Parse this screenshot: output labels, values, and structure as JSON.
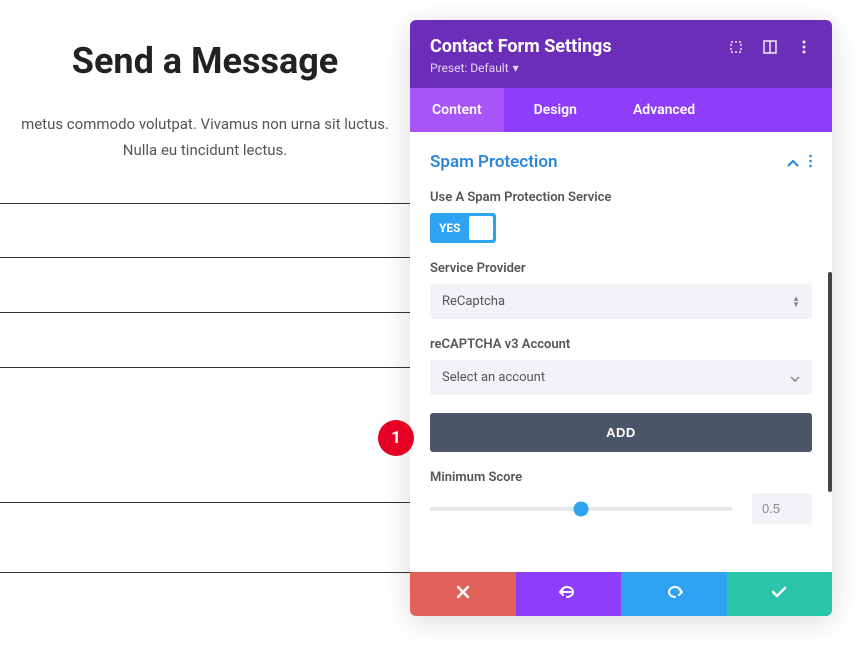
{
  "page": {
    "title": "Send a Message",
    "description": "metus commodo volutpat. Vivamus non urna sit luctus. Nulla eu tincidunt lectus."
  },
  "panel": {
    "title": "Contact Form Settings",
    "preset_label": "Preset: Default"
  },
  "tabs": {
    "content": "Content",
    "design": "Design",
    "advanced": "Advanced"
  },
  "section": {
    "title": "Spam Protection"
  },
  "settings": {
    "use_spam_label": "Use A Spam Protection Service",
    "toggle_text": "YES",
    "provider_label": "Service Provider",
    "provider_value": "ReCaptcha",
    "account_label": "reCAPTCHA v3 Account",
    "account_value": "Select an account",
    "add_button": "ADD",
    "min_score_label": "Minimum Score",
    "min_score_value": "0.5"
  },
  "marker": {
    "text": "1"
  }
}
